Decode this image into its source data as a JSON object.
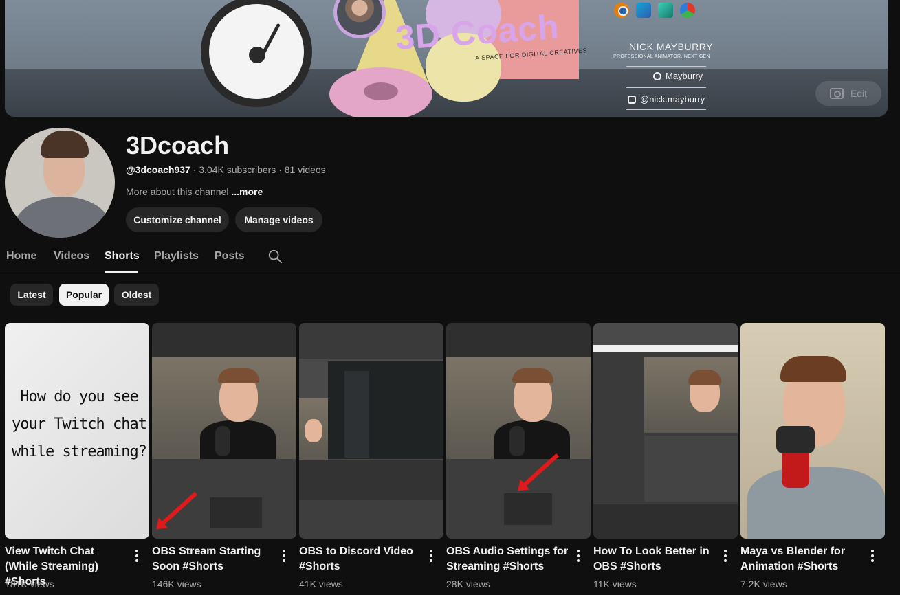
{
  "banner": {
    "title": "3D Coach",
    "tagline": "A SPACE FOR DIGITAL CREATIVES",
    "name": "NICK MAYBURRY",
    "role": "PROFESSIONAL ANIMATOR. NEXT GEN",
    "spotify": "Mayburry",
    "instagram": "@nick.mayburry",
    "edit_label": "Edit",
    "app_icons": [
      "blender-icon",
      "v-icon",
      "maya-icon",
      "davinci-icon"
    ]
  },
  "channel": {
    "name": "3Dcoach",
    "handle": "@3dcoach937",
    "stats": " · 3.04K subscribers · 81 videos",
    "about": "More about this channel",
    "more": "...more",
    "customize_label": "Customize channel",
    "manage_label": "Manage videos"
  },
  "tabs": [
    {
      "label": "Home"
    },
    {
      "label": "Videos"
    },
    {
      "label": "Shorts"
    },
    {
      "label": "Playlists"
    },
    {
      "label": "Posts"
    }
  ],
  "active_tab": "Shorts",
  "chips": [
    {
      "label": "Latest"
    },
    {
      "label": "Popular"
    },
    {
      "label": "Oldest"
    }
  ],
  "active_chip": "Popular",
  "shorts": [
    {
      "title": "View Twitch Chat (While Streaming) #Shorts",
      "views": "181K views",
      "thumb_text": "How do you see your Twitch chat while streaming?"
    },
    {
      "title": "OBS Stream Starting Soon #Shorts",
      "views": "146K views"
    },
    {
      "title": "OBS to Discord Video #Shorts",
      "views": "41K views"
    },
    {
      "title": "OBS Audio Settings for Streaming #Shorts",
      "views": "28K views"
    },
    {
      "title": "How To Look Better in OBS #Shorts",
      "views": "11K views"
    },
    {
      "title": "Maya vs Blender for Animation #Shorts",
      "views": "7.2K views"
    }
  ],
  "colors": {
    "background": "#0f0f0f",
    "text_primary": "#f1f1f1",
    "text_secondary": "#aaaaaa",
    "chip_bg": "#272727",
    "banner_title": "#d9a5ea",
    "arrow": "#e01a1a"
  }
}
